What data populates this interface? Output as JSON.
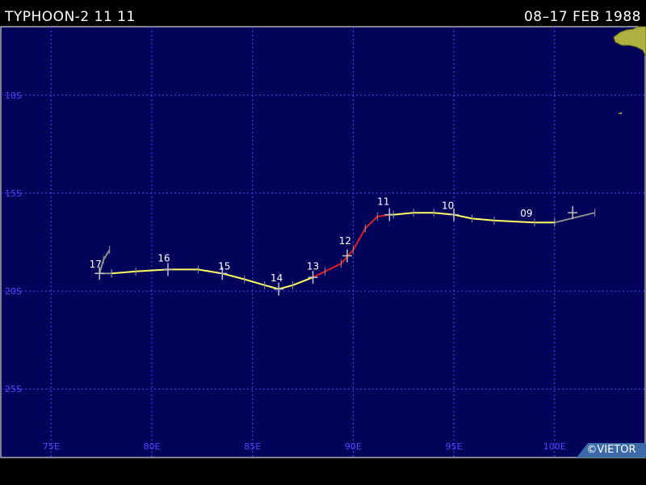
{
  "header": {
    "title": "TYPHOON-2  11 11",
    "date_range": "08–17 FEB 1988"
  },
  "credit": "©VIETOR",
  "colors": {
    "ocean": "#03035a",
    "grid": "#4a4aff",
    "land": "#b0b040",
    "track_weak": "#909090",
    "track_storm": "#ffff60",
    "track_typhoon": "#e02020",
    "label": "#ffffff"
  },
  "map": {
    "lon_range": [
      72.5,
      104.5
    ],
    "lat_range": [
      -28.5,
      -6.5
    ],
    "lon_ticks": [
      {
        "lon": 75,
        "label": "75E"
      },
      {
        "lon": 80,
        "label": "80E"
      },
      {
        "lon": 85,
        "label": "85E"
      },
      {
        "lon": 90,
        "label": "90E"
      },
      {
        "lon": 95,
        "label": "95E"
      },
      {
        "lon": 100,
        "label": "100E"
      }
    ],
    "lat_ticks": [
      {
        "lat": -10,
        "label": "10S"
      },
      {
        "lat": -15,
        "label": "15S"
      },
      {
        "lat": -20,
        "label": "20S"
      },
      {
        "lat": -25,
        "label": "25S"
      }
    ]
  },
  "track": {
    "segments": [
      {
        "intensity": "weak",
        "points": [
          [
            102.0,
            -16.0
          ],
          [
            100.0,
            -16.5
          ]
        ]
      },
      {
        "intensity": "storm",
        "points": [
          [
            100.0,
            -16.5
          ],
          [
            99.0,
            -16.5
          ],
          [
            97.0,
            -16.4
          ],
          [
            95.9,
            -16.3
          ],
          [
            95.0,
            -16.1
          ],
          [
            94.0,
            -16.0
          ],
          [
            93.0,
            -16.0
          ],
          [
            92.0,
            -16.1
          ],
          [
            91.8,
            -16.1
          ]
        ]
      },
      {
        "intensity": "typhoon",
        "points": [
          [
            91.8,
            -16.1
          ],
          [
            91.2,
            -16.2
          ],
          [
            90.6,
            -16.8
          ],
          [
            90.0,
            -17.9
          ],
          [
            89.4,
            -18.6
          ],
          [
            88.6,
            -19.0
          ],
          [
            88.0,
            -19.3
          ]
        ]
      },
      {
        "intensity": "storm",
        "points": [
          [
            88.0,
            -19.3
          ],
          [
            87.0,
            -19.7
          ],
          [
            86.3,
            -19.9
          ],
          [
            85.6,
            -19.7
          ],
          [
            84.6,
            -19.4
          ],
          [
            83.5,
            -19.1
          ],
          [
            82.3,
            -18.9
          ],
          [
            80.8,
            -18.9
          ],
          [
            79.2,
            -19.0
          ],
          [
            78.0,
            -19.1
          ]
        ]
      },
      {
        "intensity": "weak",
        "points": [
          [
            78.0,
            -19.1
          ],
          [
            77.4,
            -19.1
          ],
          [
            77.6,
            -18.4
          ],
          [
            77.9,
            -17.9
          ]
        ]
      }
    ],
    "day_labels": [
      {
        "lon": 98.6,
        "lat": -16.2,
        "label": "09"
      },
      {
        "lon": 94.7,
        "lat": -15.8,
        "label": "10"
      },
      {
        "lon": 91.5,
        "lat": -15.6,
        "label": "11"
      },
      {
        "lon": 89.6,
        "lat": -17.6,
        "label": "12"
      },
      {
        "lon": 88.0,
        "lat": -18.9,
        "label": "13"
      },
      {
        "lon": 86.2,
        "lat": -19.5,
        "label": "14"
      },
      {
        "lon": 83.6,
        "lat": -18.9,
        "label": "15"
      },
      {
        "lon": 80.6,
        "lat": -18.5,
        "label": "16"
      },
      {
        "lon": 77.2,
        "lat": -18.8,
        "label": "17"
      }
    ],
    "day_markers": [
      [
        100.9,
        -16.0
      ],
      [
        95.0,
        -16.1
      ],
      [
        91.8,
        -16.1
      ],
      [
        89.7,
        -18.2
      ],
      [
        88.0,
        -19.3
      ],
      [
        86.3,
        -19.9
      ],
      [
        83.5,
        -19.1
      ],
      [
        80.8,
        -18.9
      ],
      [
        77.4,
        -19.1
      ]
    ]
  }
}
